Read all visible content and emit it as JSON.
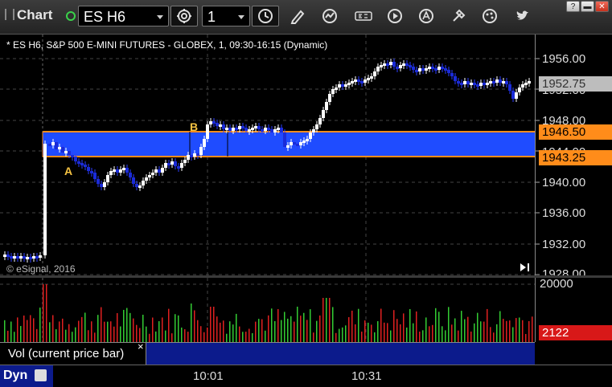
{
  "toolbar": {
    "title": "Chart",
    "symbol": "ES H6",
    "interval": "1"
  },
  "chart": {
    "header": "* ES H6, S&P 500 E-MINI FUTURES - GLOBEX, 1, 09:30-16:15 (Dynamic)",
    "copyright": "© eSignal, 2016",
    "price_scale": [
      "1956.00",
      "1952.00",
      "1948.00",
      "1944.00",
      "1940.00",
      "1936.00",
      "1932.00",
      "1928.00"
    ],
    "last_price": "1952.75",
    "upper_level": "1946.50",
    "lower_level": "1943.25",
    "label_a": "A",
    "label_b": "B",
    "colors": {
      "zone": "#1f4cff",
      "zone_border": "#ff8c1a",
      "up_candle": "#ffffff",
      "down_candle": "#1a2bd8",
      "up_volume": "#33cc33",
      "down_volume": "#e02020"
    }
  },
  "volume": {
    "scale_top": "20000",
    "current": "2122",
    "study_label": "Vol (current price bar)",
    "close_glyph": "×"
  },
  "time_axis": {
    "labels": [
      "10:01",
      "10:31"
    ],
    "dyn_label": "Dyn"
  }
}
